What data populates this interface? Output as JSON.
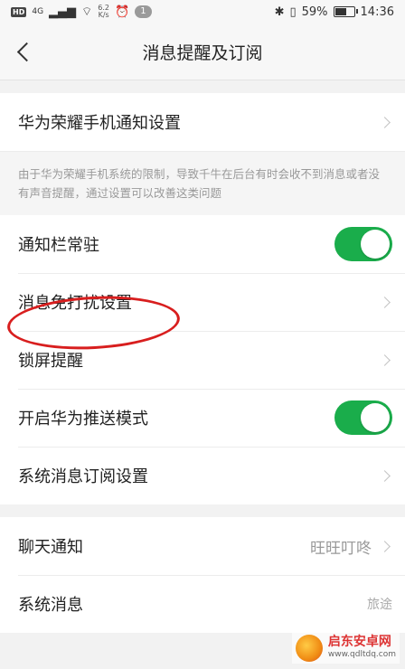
{
  "status_bar": {
    "hd": "HD",
    "network": "4G",
    "speed_value": "6.2",
    "speed_unit": "K/s",
    "notification_count": "1",
    "battery_percent": "59%",
    "time": "14:36"
  },
  "nav": {
    "title": "消息提醒及订阅"
  },
  "group1": {
    "item_label": "华为荣耀手机通知设置",
    "note": "由于华为荣耀手机系统的限制，导致千牛在后台有时会收不到消息或者没有声音提醒，通过设置可以改善这类问题"
  },
  "group2": {
    "items": [
      {
        "label": "通知栏常驻",
        "toggle_on": true
      },
      {
        "label": "消息免打扰设置"
      },
      {
        "label": "锁屏提醒"
      },
      {
        "label": "开启华为推送模式",
        "toggle_on": true
      },
      {
        "label": "系统消息订阅设置"
      }
    ]
  },
  "group3": {
    "items": [
      {
        "label": "聊天通知",
        "value": "旺旺叮咚"
      },
      {
        "label": "系统消息",
        "value": "旅途"
      }
    ]
  },
  "watermark": {
    "title": "启东安卓网",
    "url": "www.qdltdq.com"
  },
  "colors": {
    "toggle_on": "#1aad4b",
    "highlight_ring": "#d81e1e"
  }
}
